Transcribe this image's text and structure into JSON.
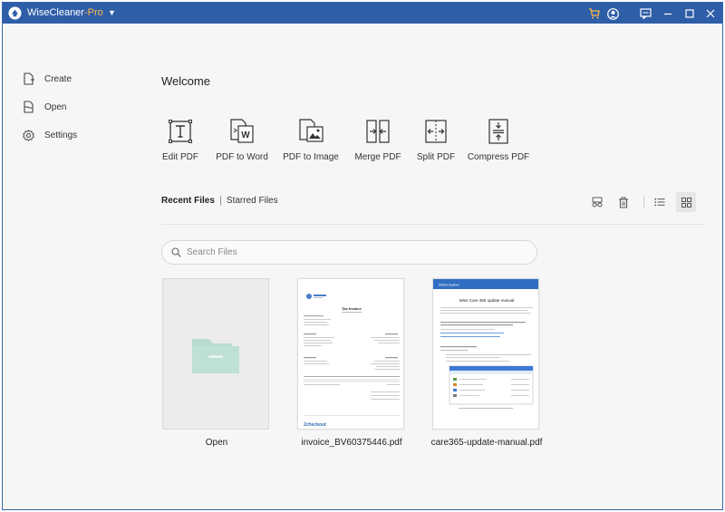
{
  "titlebar": {
    "app_name": "WiseCleaner",
    "app_suffix": "-Pro",
    "dropdown_glyph": "▼",
    "icons": [
      "cart-icon",
      "account-icon",
      "feedback-icon",
      "minimize-icon",
      "maximize-icon",
      "close-icon"
    ],
    "accent_color": "#2f5ea8"
  },
  "sidebar": {
    "items": [
      {
        "label": "Create",
        "icon": "create-icon"
      },
      {
        "label": "Open",
        "icon": "open-icon"
      },
      {
        "label": "Settings",
        "icon": "gear-icon"
      }
    ]
  },
  "main": {
    "welcome": "Welcome",
    "tools": [
      {
        "label": "Edit PDF",
        "icon": "edit-pdf-icon"
      },
      {
        "label": "PDF to Word",
        "icon": "pdf-to-word-icon"
      },
      {
        "label": "PDF to Image",
        "icon": "pdf-to-image-icon"
      },
      {
        "label": "Merge PDF",
        "icon": "merge-pdf-icon"
      },
      {
        "label": "Split PDF",
        "icon": "split-pdf-icon"
      },
      {
        "label": "Compress PDF",
        "icon": "compress-pdf-icon"
      }
    ],
    "tabs": {
      "recent": "Recent Files",
      "starred": "Starred Files"
    },
    "view_tools": [
      "glasses-icon",
      "trash-icon",
      "list-view-icon",
      "grid-view-icon"
    ],
    "search": {
      "placeholder": "Search Files"
    },
    "files": [
      {
        "name": "Open"
      },
      {
        "name": "invoice_BV60375446.pdf"
      },
      {
        "name": "care365-update-manual.pdf"
      }
    ]
  },
  "thumbnails": {
    "invoice": {
      "heading": "Tax Invoice",
      "brand": "2checkout"
    },
    "manual": {
      "heading": "Wise Care 365 update manual",
      "brand": "WiseCleaner"
    }
  }
}
